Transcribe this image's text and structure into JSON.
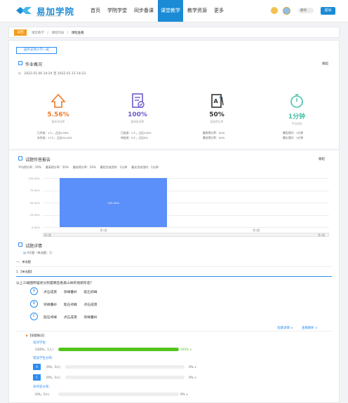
{
  "header": {
    "brand": "易加学院",
    "brand_sub": "SMART COLLEGE",
    "nav": [
      "首页",
      "学院学堂",
      "同步备课",
      "课堂教学",
      "教学资源",
      "更多"
    ],
    "user_name": "教师",
    "exit_label": "退出"
  },
  "breadcrumb": {
    "back_label": "返回",
    "items": [
      "课堂教学",
      "课程列表",
      "课程查看"
    ],
    "separator": "/"
  },
  "class_tag": "园外支持小学一班",
  "overview": {
    "title": "作业概况",
    "collapse": "收起",
    "time_range": "2022.01.06 14:24 至 2022.01.13 14:23",
    "stats": [
      {
        "value": "5.56%",
        "caption": "整体完成率",
        "color": "#f07a2a",
        "lines": [
          "已完成：1人，占比5.59%",
          "未完成：17人，占比94.44%"
        ]
      },
      {
        "value": "100%",
        "caption": "整体批阅率",
        "color": "#6a5acd",
        "lines": [
          "已批阅：1人，占比100%",
          "待批阅：0人，占比0%"
        ]
      },
      {
        "value": "50%",
        "caption": "班级得分率",
        "color": "#333333",
        "lines": [
          "最高得分率：50%",
          "最低得分率：50%"
        ]
      },
      {
        "value": "1分钟",
        "caption": "平均用时",
        "color": "#49c2a8",
        "lines": [
          "最短用时：1分钟",
          "最长用时：1分钟"
        ]
      }
    ]
  },
  "report": {
    "title": "试题作答报告",
    "collapse": "收起",
    "legend": [
      "平均得分率：50%",
      "最高得分率：50%",
      "最低得分率：50%",
      "最短完成用时：1分钟",
      "最长完成用时：1分钟"
    ]
  },
  "chart_data": {
    "type": "bar",
    "categories": [
      "第1题"
    ],
    "values": [
      100
    ],
    "data_labels": [
      "100.00%"
    ],
    "y_ticks": [
      "100.00%",
      "75.00%",
      "50.00%",
      "25.00%",
      "0.00%"
    ],
    "ylim": [
      0,
      100
    ],
    "x_tick_labels": [
      "第1题",
      "第1题"
    ],
    "scroll_labels": [
      "第1题",
      "第1题"
    ],
    "bar_color": "#5b8ff9",
    "grid": true
  },
  "detail": {
    "title": "试题详情",
    "summary": "共1题（单选题：1）",
    "section": "一、单选题",
    "question_tag": "1.【单选题】",
    "question_text": "以上三幅图所描述分别是哪些各类山体的地貌形态？",
    "options": [
      {
        "letter": "A",
        "words": [
          "点石成景",
          "崇嶂叠岭",
          "陡石祁峰"
        ]
      },
      {
        "letter": "B",
        "words": [
          "崇嶂叠岭",
          "陡石祁峰",
          "点石成景"
        ]
      },
      {
        "letter": "C",
        "words": [
          "陡石祁峰",
          "点石成景",
          "崇嶂叠岭"
        ]
      }
    ],
    "links": [
      "答题详情 ∧",
      "查看解析 ∨"
    ],
    "answer_label": "【答题情况】",
    "correct_label": "答对学生:",
    "correct_stat": "（100%，1人）",
    "correct_pct": "100%",
    "correct_fraction": 1.0,
    "wrong_label": "错误学生分布:",
    "wrong_rows": [
      {
        "letter": "A",
        "stat": "（0%，0人）",
        "pct": "0%",
        "fraction": 0
      },
      {
        "letter": "C",
        "stat": "（0%，0人）",
        "pct": "0%",
        "fraction": 0
      }
    ],
    "unanswered_label": "未作答分布:",
    "unanswered_stat": "（0%，0人）",
    "unanswered_pct": "0%",
    "unanswered_fraction": 0
  }
}
